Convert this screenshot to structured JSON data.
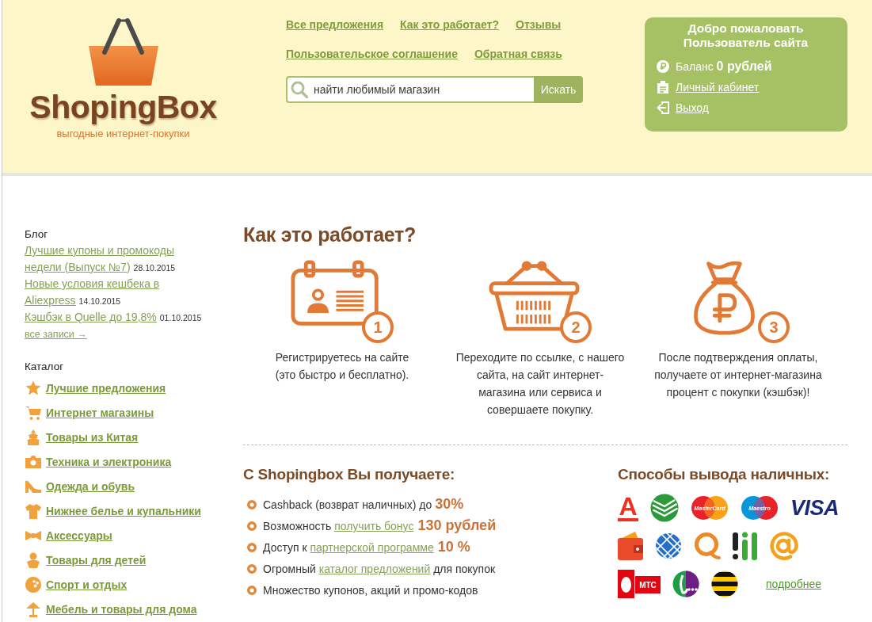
{
  "header": {
    "logo": {
      "name": "ShopingBox",
      "tagline": "выгодные интернет-покупки"
    },
    "nav_rows": [
      [
        "Все предложения",
        "Как это работает?",
        "Отзывы"
      ],
      [
        "Пользовательское соглашение",
        "Обратная связь"
      ]
    ],
    "search": {
      "placeholder": "найти любимый магазин",
      "button": "Искать"
    },
    "user_panel": {
      "greeting": "Добро пожаловать",
      "user": "Пользователь сайта",
      "balance": "Баланс **0 рублей**",
      "links": [
        "Личный кабинет",
        "Выход"
      ]
    }
  },
  "sidebar": {
    "blog": {
      "title": "Блог",
      "posts": [
        {
          "title": "Лучшие купоны и промокоды недели (Выпуск №7)",
          "date": "28.10.2015"
        },
        {
          "title": "Новые условия кешбека в Aliexpress",
          "date": "14.10.2015"
        },
        {
          "title": "Кэшбэк в Quelle до 19,8%",
          "date": "01.10.2015"
        }
      ],
      "all_link": "все записи →"
    },
    "catalog": {
      "title": "Каталог",
      "items": [
        "Лучшие предложения",
        "Интернет магазины",
        "Товары из Китая",
        "Техника и электроника",
        "Одежда и обувь",
        "Нижнее белье и купальники",
        "Аксессуары",
        "Товары для детей",
        "Спорт и отдых",
        "Мебель и товары для дома"
      ]
    }
  },
  "how_it_works": {
    "title": "Как это работает?",
    "steps": [
      {
        "number": "1",
        "text": "Регистрируетесь на сайте (это быстро и бесплатно)."
      },
      {
        "number": "2",
        "text": "Переходите по ссылке, с нашего сайта, на сайт интернет-магазина или сервиса и совершаете покупку."
      },
      {
        "number": "3",
        "text": "После подтверждения оплаты, получаете от интернет-магазина процент с покупки (кэшбэк)!"
      }
    ]
  },
  "benefits": {
    "title": "С Shopingbox Вы получаете:",
    "items": [
      [
        {
          "kind": "text",
          "text": "Cashback (возврат наличных) до "
        },
        {
          "kind": "accent",
          "text": "30%"
        }
      ],
      [
        {
          "kind": "text",
          "text": "Возможность "
        },
        {
          "kind": "link",
          "text": "получить бонус"
        },
        {
          "kind": "accent",
          "text": " 130 рублей"
        }
      ],
      [
        {
          "kind": "text",
          "text": "Доступ к "
        },
        {
          "kind": "link",
          "text": "партнерской программе"
        },
        {
          "kind": "accent",
          "text": " 10 %"
        }
      ],
      [
        {
          "kind": "text",
          "text": "Огромный "
        },
        {
          "kind": "link",
          "text": "каталог предложений"
        },
        {
          "kind": "text",
          "text": " для покупок"
        }
      ],
      [
        {
          "kind": "text",
          "text": "Множество купонов, акций и промо-кодов"
        }
      ]
    ]
  },
  "payments": {
    "title": "Способы вывода наличных:",
    "rows": [
      [
        {
          "kind": "letter",
          "label": "А"
        },
        {
          "kind": "leaf"
        },
        {
          "kind": "mastercard",
          "label": "MasterCard"
        },
        {
          "kind": "maestro",
          "label": "Maestro"
        },
        {
          "kind": "visa",
          "label": "VISA"
        }
      ],
      [
        {
          "kind": "wallet"
        },
        {
          "kind": "globe"
        },
        {
          "kind": "ring"
        },
        {
          "kind": "bars"
        },
        {
          "kind": "at"
        }
      ],
      [
        {
          "kind": "egg",
          "label": "МТС"
        },
        {
          "kind": "dots"
        },
        {
          "kind": "stripes"
        }
      ]
    ],
    "more_link": "подробнее"
  }
}
